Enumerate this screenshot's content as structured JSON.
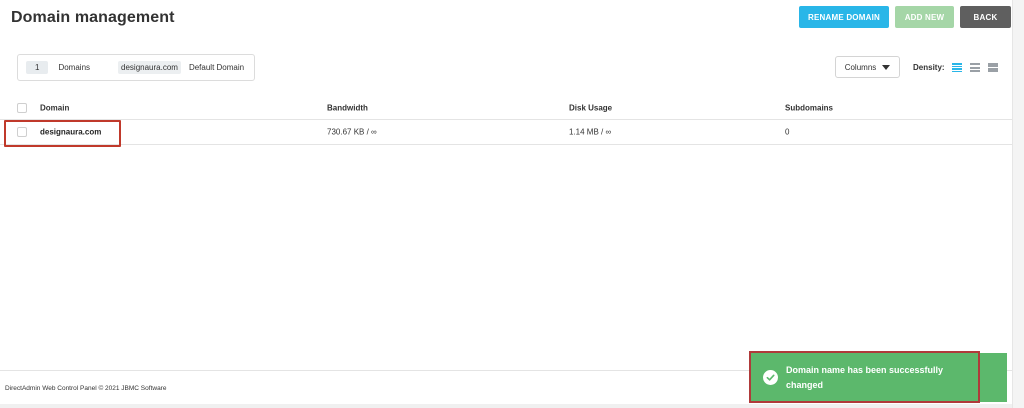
{
  "header": {
    "title": "Domain management",
    "buttons": {
      "rename": "RENAME DOMAIN",
      "add": "ADD NEW",
      "back": "BACK"
    }
  },
  "summary": {
    "count": "1",
    "label": "Domains",
    "default_domain": "designaura.com",
    "default_label": "Default Domain"
  },
  "toolbar": {
    "columns_label": "Columns",
    "density_label": "Density:"
  },
  "table": {
    "columns": [
      "Domain",
      "Bandwidth",
      "Disk Usage",
      "Subdomains"
    ],
    "rows": [
      {
        "domain": "designaura.com",
        "bandwidth": "730.67 KB / ∞",
        "disk": "1.14 MB / ∞",
        "subdomains": "0"
      }
    ]
  },
  "footer": {
    "text": "DirectAdmin Web Control Panel © 2021 JBMC Software"
  },
  "toast": {
    "message": "Domain name has been successfully changed"
  },
  "colors": {
    "primary": "#29b6e8",
    "add_disabled": "#a5d6a7",
    "back": "#5f5f5f",
    "success": "#5cb86c",
    "highlight": "#c0392b"
  }
}
